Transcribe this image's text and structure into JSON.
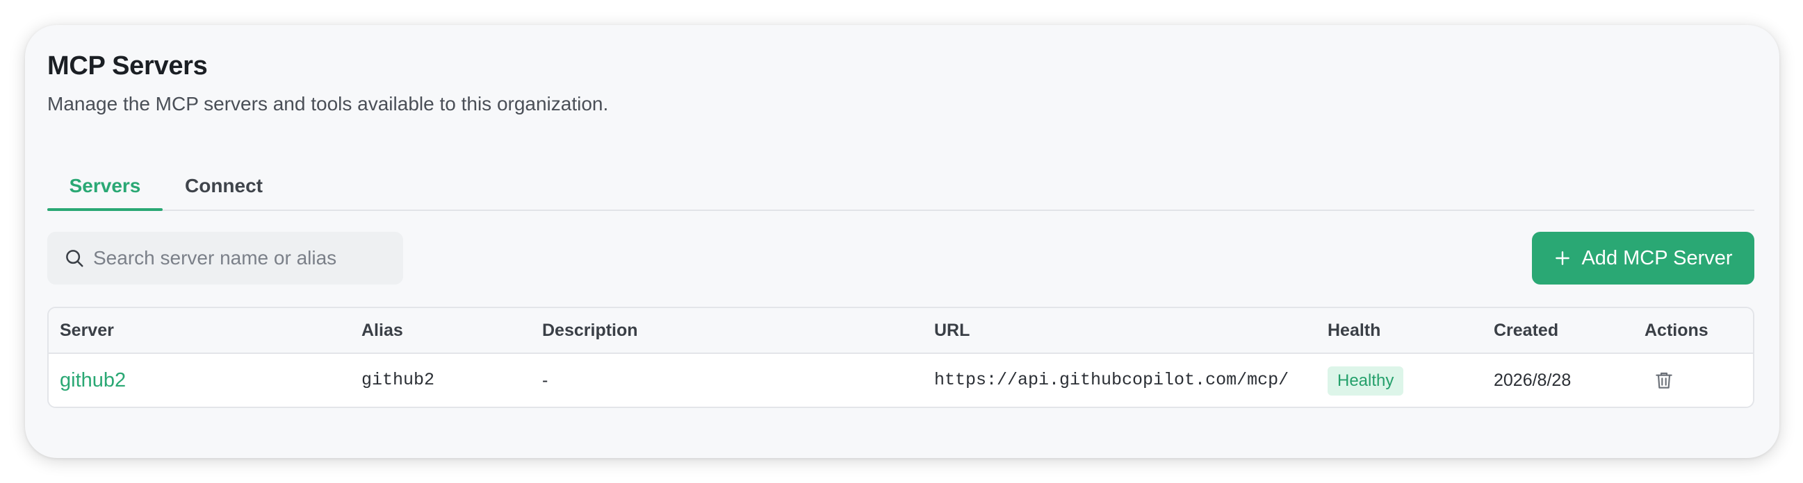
{
  "page": {
    "title": "MCP Servers",
    "subtitle": "Manage the MCP servers and tools available to this organization."
  },
  "tabs": [
    {
      "label": "Servers",
      "active": true
    },
    {
      "label": "Connect",
      "active": false
    }
  ],
  "search": {
    "placeholder": "Search server name or alias",
    "value": "",
    "icon": "search-icon"
  },
  "actions": {
    "add_label": "Add MCP Server",
    "add_icon": "plus-icon"
  },
  "table": {
    "columns": [
      "Server",
      "Alias",
      "Description",
      "URL",
      "Health",
      "Created",
      "Actions"
    ],
    "rows": [
      {
        "server": "github2",
        "alias": "github2",
        "description": "-",
        "url": "https://api.githubcopilot.com/mcp/",
        "health": "Healthy",
        "created": "2026/8/28",
        "action_icon": "trash-icon"
      }
    ]
  },
  "colors": {
    "accent": "#2aa874",
    "healthy_bg": "#ddf5e9",
    "healthy_text": "#25a06b"
  }
}
